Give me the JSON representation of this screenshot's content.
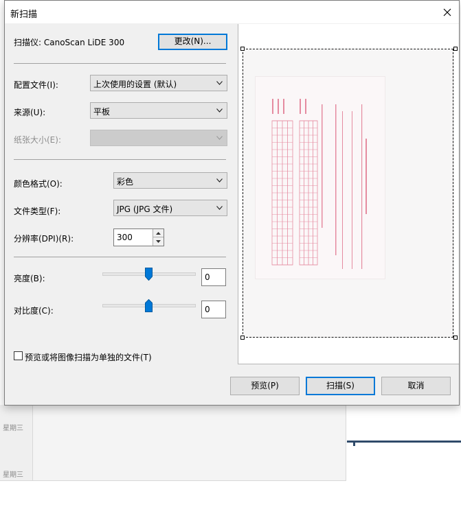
{
  "background": {
    "days": [
      "星期三",
      "星期三"
    ]
  },
  "dialog": {
    "title": "新扫描",
    "scanner_label": "扫描仪: CanoScan LiDE 300",
    "change_button": "更改(N)...",
    "profile_label": "配置文件(I):",
    "profile_value": "上次使用的设置 (默认)",
    "source_label": "来源(U):",
    "source_value": "平板",
    "paper_size_label": "纸张大小(E):",
    "paper_size_value": "",
    "color_format_label": "颜色格式(O):",
    "color_format_value": "彩色",
    "file_type_label": "文件类型(F):",
    "file_type_value": "JPG (JPG 文件)",
    "resolution_label": "分辨率(DPI)(R):",
    "resolution_value": "300",
    "brightness_label": "亮度(B):",
    "brightness_value": "0",
    "brightness_level": 0.5,
    "contrast_label": "对比度(C):",
    "contrast_value": "0",
    "contrast_level": 0.5,
    "separate_files_label": "预览或将图像扫描为单独的文件(T)",
    "separate_files_checked": false,
    "preview_button": "预览(P)",
    "scan_button": "扫描(S)",
    "cancel_button": "取消"
  },
  "colors": {
    "accent": "#0078d7",
    "doc_ink": "#e0708a"
  }
}
